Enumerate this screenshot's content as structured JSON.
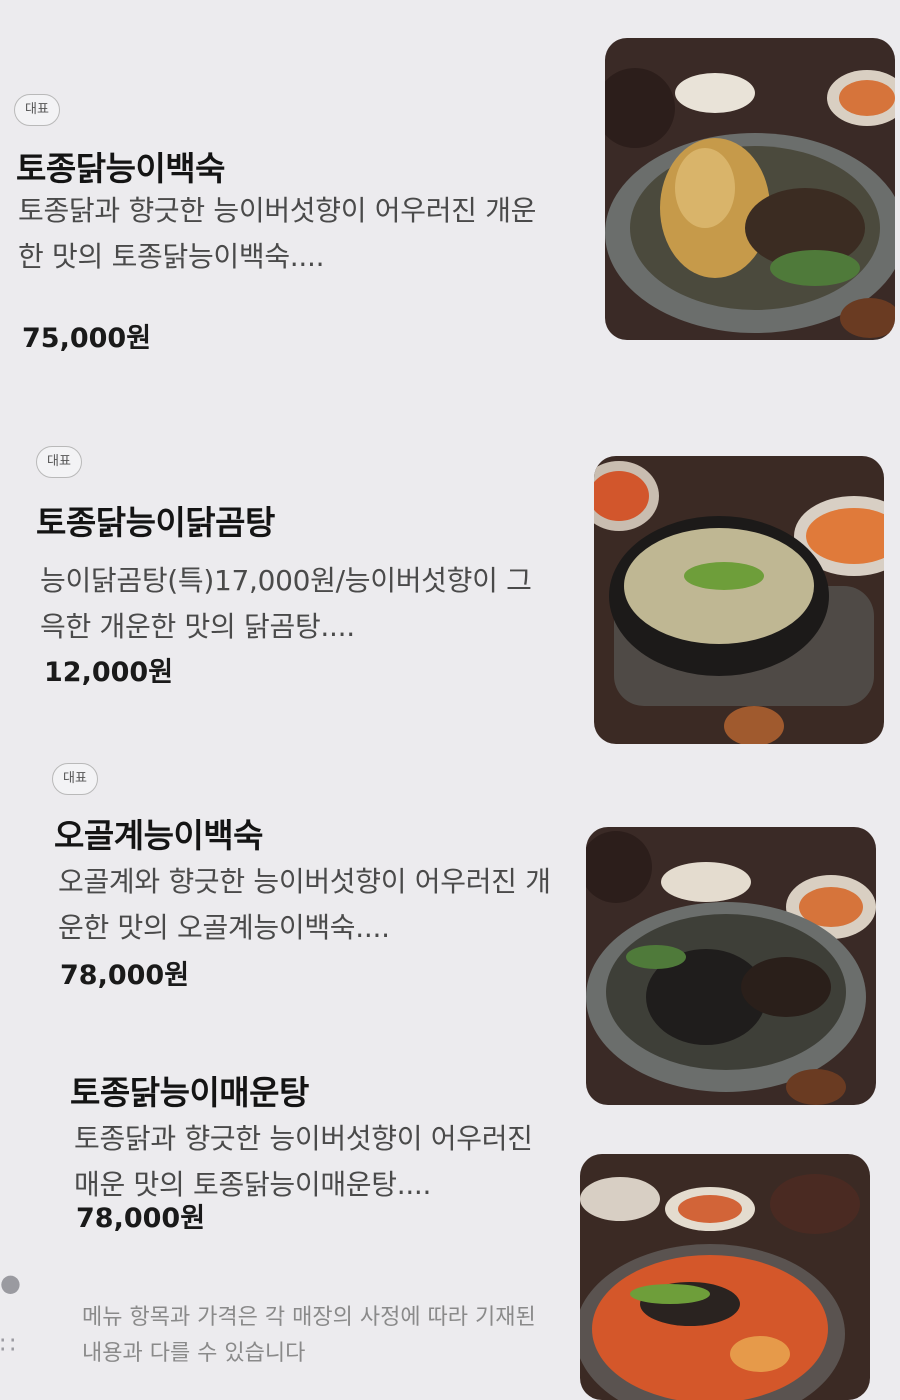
{
  "badge_label": "대표",
  "menu": [
    {
      "name": "토종닭능이백숙",
      "description": "토종닭과 향긋한 능이버섯향이 어우러진 개운한 맛의 토종닭능이백숙....",
      "price": "75,000원",
      "has_badge": true,
      "image_icon": "chicken-soup-photo"
    },
    {
      "name": "토종닭능이닭곰탕",
      "description": "능이닭곰탕(특)17,000원/능이버섯향이 그윽한 개운한 맛의 닭곰탕....",
      "price": "12,000원",
      "has_badge": true,
      "image_icon": "chicken-gomtang-photo"
    },
    {
      "name": "오골계능이백숙",
      "description": "오골계와 향긋한 능이버섯향이 어우러진 개운한 맛의 오골계능이백숙....",
      "price": "78,000원",
      "has_badge": true,
      "image_icon": "silkie-soup-photo"
    },
    {
      "name": "토종닭능이매운탕",
      "description": "토종닭과 향긋한 능이버섯향이 어우러진 매운 맛의 토종닭능이매운탕....",
      "price": "78,000원",
      "has_badge": false,
      "image_icon": "spicy-stew-photo"
    }
  ],
  "footer_notice": "메뉴 항목과 가격은 각 매장의 사정에 따라 기재된 내용과 다를 수 있습니다",
  "colors": {
    "background": "#ecebee",
    "text_primary": "#141414",
    "text_secondary": "#4a4a4a",
    "badge_border": "#b9b9b9"
  }
}
